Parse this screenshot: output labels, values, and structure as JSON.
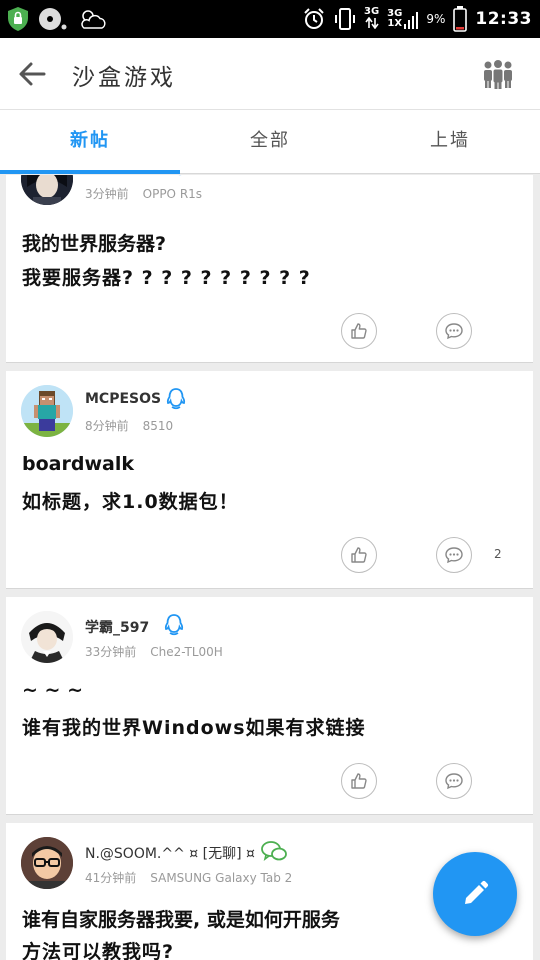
{
  "status_bar": {
    "network_top": "3G",
    "network2_top": "3G",
    "network2_bottom": "1X",
    "battery": "9%",
    "time": "12:33"
  },
  "header": {
    "title": "沙盒游戏"
  },
  "tabs": [
    {
      "label": "新帖",
      "active": true
    },
    {
      "label": "全部",
      "active": false
    },
    {
      "label": "上墙",
      "active": false
    }
  ],
  "posts": [
    {
      "username": "",
      "time_ago": "3分钟前",
      "device": "OPPO R1s",
      "badge": "qq-icon",
      "title": "我的世界服务器?",
      "body": "我要服务器? ? ? ? ? ? ? ? ? ?",
      "comment_count": ""
    },
    {
      "username": "MCPESOS",
      "time_ago": "8分钟前",
      "device": "8510",
      "badge": "qq-icon",
      "title": "boardwalk",
      "body": "如标题，求1.0数据包！",
      "comment_count": "2"
    },
    {
      "username": "学霸_597",
      "time_ago": "33分钟前",
      "device": "Che2-TL00H",
      "badge": "qq-icon",
      "title": "~ ~ ~",
      "body": "谁有我的世界Windows如果有求链接",
      "comment_count": ""
    },
    {
      "username": "N.@SOOM.^^ ¤ [无聊] ¤",
      "time_ago": "41分钟前",
      "device": "SAMSUNG Galaxy Tab 2",
      "badge": "wechat-icon",
      "title": "谁有自家服务器我要, 或是如何开服务",
      "body": "方法可以教我吗?",
      "comment_count": ""
    }
  ],
  "colors": {
    "accent": "#2196f3",
    "qq": "#2196f3",
    "wechat": "#4caf50"
  }
}
